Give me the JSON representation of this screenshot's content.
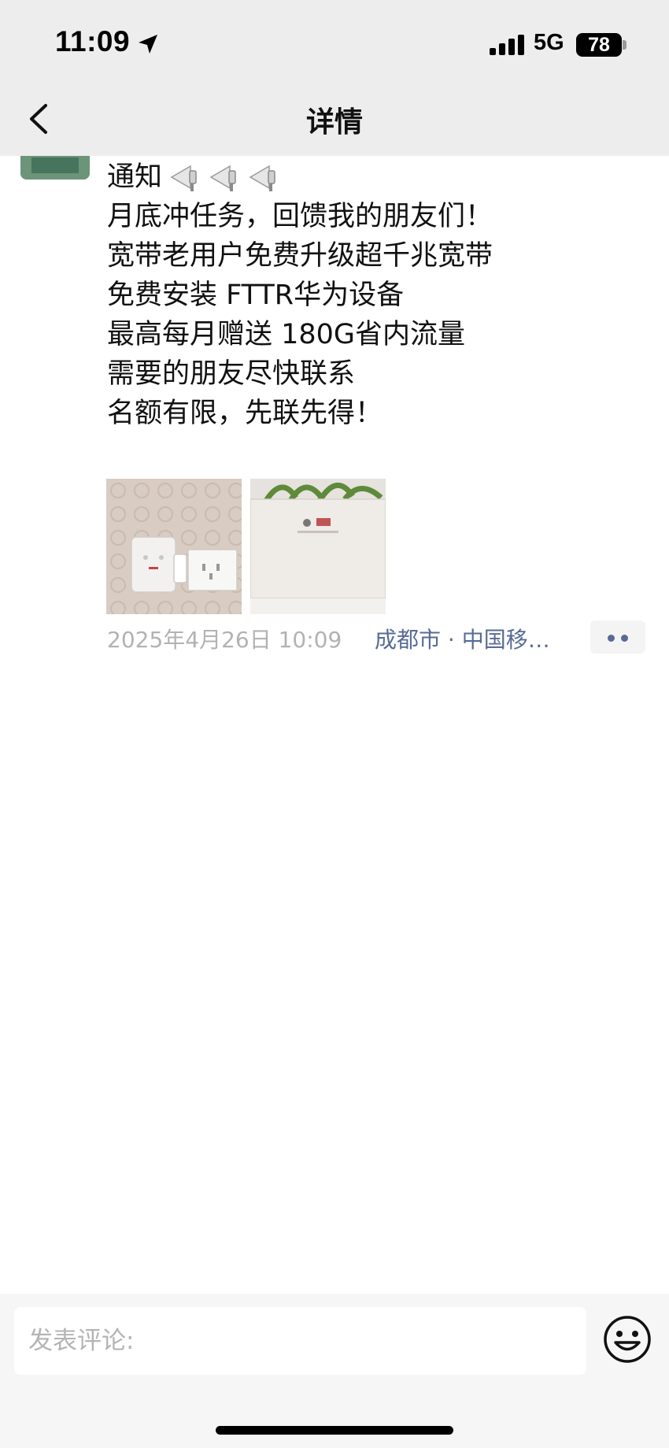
{
  "status_bar": {
    "time": "11:09",
    "network": "5G",
    "battery": "78"
  },
  "nav": {
    "title": "详情"
  },
  "post": {
    "lines": [
      "通知",
      "月底冲任务，回馈我的朋友们！",
      "宽带老用户免费升级超千兆宽带",
      "免费安装 FTTR华为设备",
      "最高每月赠送 180G省内流量",
      "需要的朋友尽快联系",
      "名额有限，先联先得！"
    ],
    "timestamp": "2025年4月26日 10:09",
    "location": "成都市 · 中国移…",
    "photos": [
      "photo-router-wall-socket",
      "photo-router-box"
    ]
  },
  "comment_bar": {
    "placeholder": "发表评论:"
  },
  "icons": {
    "location": "location-arrow-icon",
    "signal": "cellular-signal-icon",
    "back": "chevron-left-icon",
    "announce": "megaphone-icon",
    "more": "more-dots-icon",
    "emoji": "smiley-face-icon"
  },
  "colors": {
    "nav_background": "#ededed",
    "link_blue": "#576b95",
    "meta_gray": "#b2b2b2",
    "bottom_bar": "#f6f6f6"
  }
}
